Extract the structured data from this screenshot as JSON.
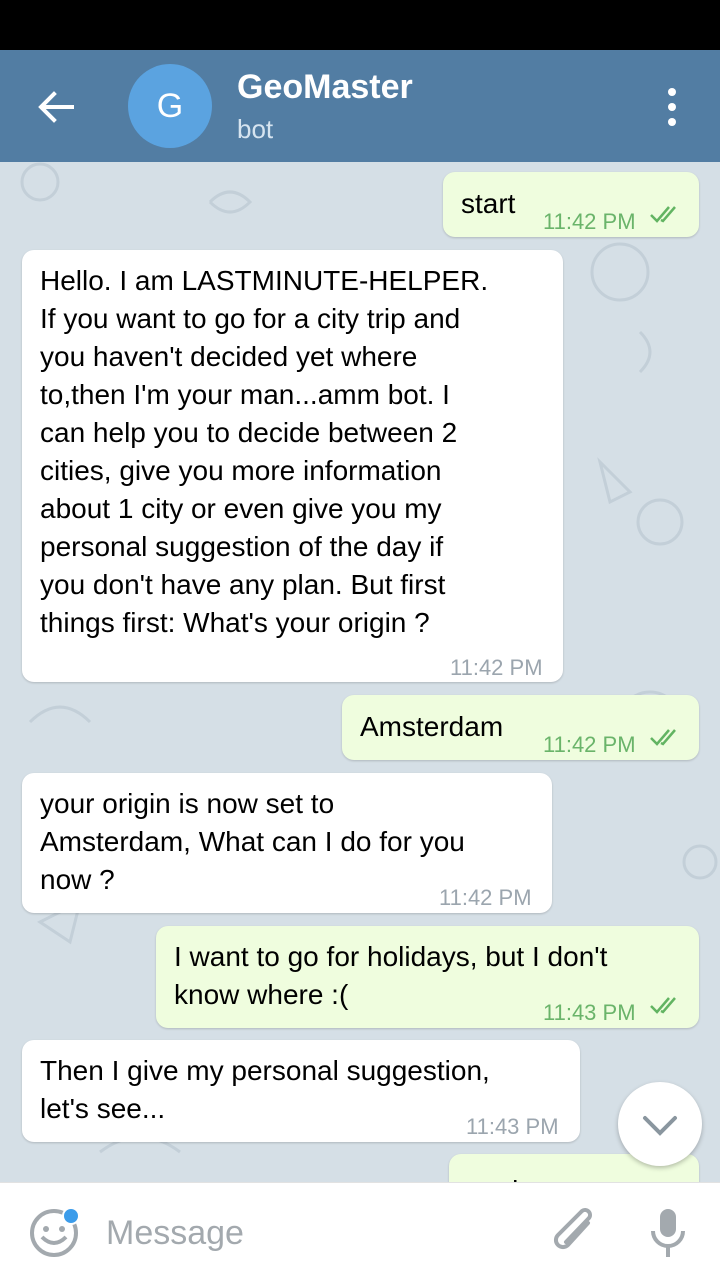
{
  "header": {
    "title": "GeoMaster",
    "subtitle": "bot",
    "avatar_letter": "G"
  },
  "messages": [
    {
      "dir": "out",
      "text": "start",
      "time": "11:42 PM",
      "read": true
    },
    {
      "dir": "in",
      "text": "Hello. I am LASTMINUTE-HELPER.\nIf you want to go for a city trip and\nyou haven't decided yet where\nto,then I'm your man...amm bot. I\ncan help you to decide between 2\ncities, give you more information\nabout 1 city or even give you my\npersonal suggestion of the day if\nyou don't have any plan. But first\nthings first: What's your origin ?",
      "time": "11:42 PM"
    },
    {
      "dir": "out",
      "text": "Amsterdam",
      "time": "11:42 PM",
      "read": true
    },
    {
      "dir": "in",
      "text": "your origin is now set to\nAmsterdam, What can I do for you\nnow ?",
      "time": "11:42 PM"
    },
    {
      "dir": "out",
      "text": "I want to go for holidays, but I don't\nknow where :(",
      "time": "11:43 PM",
      "read": true
    },
    {
      "dir": "in",
      "text": "Then I give my personal suggestion,\nlet's see...",
      "time": "11:43 PM"
    },
    {
      "dir": "out",
      "text": "cool",
      "time": "",
      "read": false
    }
  ],
  "input": {
    "placeholder": "Message"
  },
  "colors": {
    "header": "#527da3",
    "outgoing_bubble": "#effdde",
    "incoming_bubble": "#ffffff",
    "accent": "#5ba3e0",
    "chat_background": "#d5dfe6"
  },
  "icons": [
    "back-arrow-icon",
    "more-vertical-icon",
    "read-check-icon",
    "scroll-down-icon",
    "emoji-icon",
    "attach-icon",
    "mic-icon"
  ]
}
